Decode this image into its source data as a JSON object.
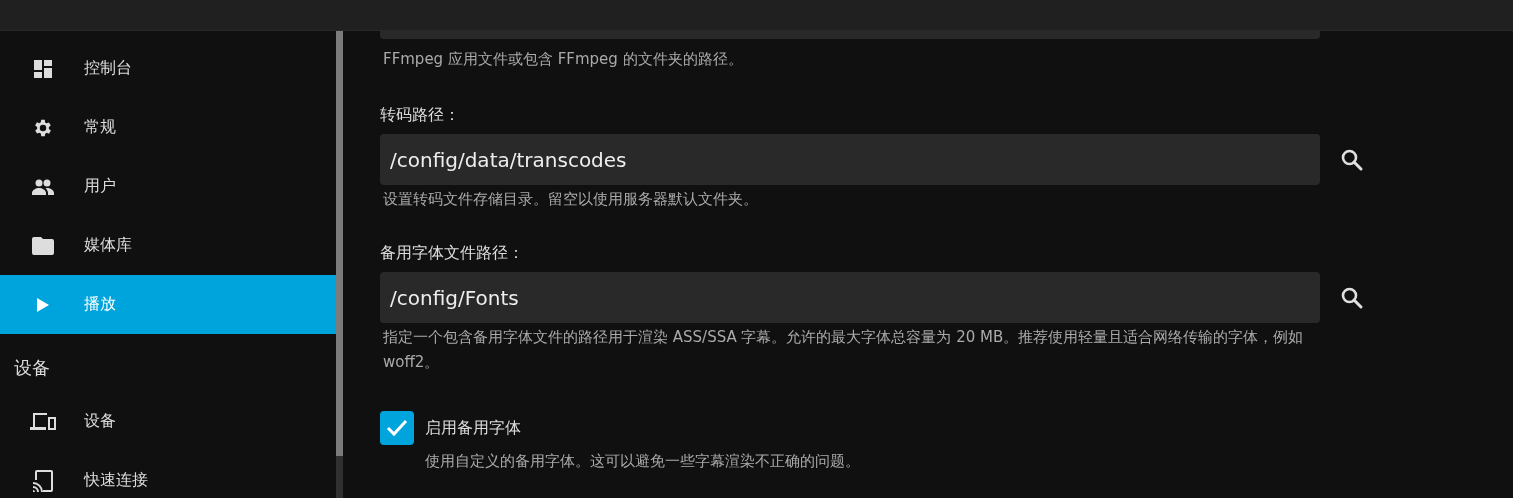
{
  "sidebar": {
    "items": [
      {
        "label": "控制台",
        "kind": "dashboard",
        "selected": false
      },
      {
        "label": "常规",
        "kind": "gear",
        "selected": false
      },
      {
        "label": "用户",
        "kind": "people",
        "selected": false
      },
      {
        "label": "媒体库",
        "kind": "folder",
        "selected": false
      },
      {
        "label": "播放",
        "kind": "play",
        "selected": true
      }
    ],
    "sections": [
      {
        "title": "设备",
        "items": [
          {
            "label": "设备",
            "kind": "devices",
            "selected": false
          },
          {
            "label": "快速连接",
            "kind": "cast",
            "selected": false
          }
        ]
      }
    ]
  },
  "content": {
    "top_hint": "FFmpeg 应用文件或包含 FFmpeg 的文件夹的路径。",
    "fields": [
      {
        "label": "转码路径：",
        "value": "/config/data/transcodes",
        "hint": "设置转码文件存储目录。留空以使用服务器默认文件夹。"
      },
      {
        "label": "备用字体文件路径：",
        "value": "/config/Fonts",
        "hint": "指定一个包含备用字体文件的路径用于渲染 ASS/SSA 字幕。允许的最大字体总容量为 20 MB。推荐使用轻量且适合网络传输的字体，例如 woff2。"
      }
    ],
    "checkbox": {
      "label": "启用备用字体",
      "checked": true,
      "hint": "使用自定义的备用字体。这可以避免一些字幕渲染不正确的问题。"
    }
  }
}
